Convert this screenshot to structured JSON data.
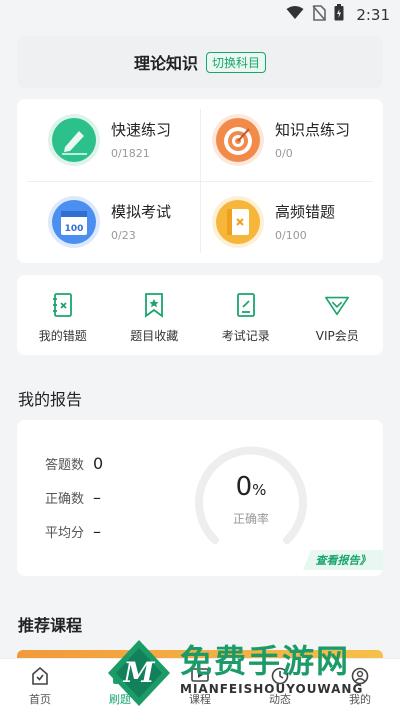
{
  "status": {
    "time": "2:31"
  },
  "subject": {
    "title": "理论知识",
    "switch_label": "切换科目"
  },
  "practice": [
    {
      "title": "快速练习",
      "count": "0/1821",
      "icon": "pen-icon"
    },
    {
      "title": "知识点练习",
      "count": "0/0",
      "icon": "target-icon"
    },
    {
      "title": "模拟考试",
      "count": "0/23",
      "icon": "exam-calendar-icon"
    },
    {
      "title": "高频错题",
      "count": "0/100",
      "icon": "wrong-book-icon"
    }
  ],
  "tools": [
    {
      "label": "我的错题",
      "icon": "wrong-notebook-icon"
    },
    {
      "label": "题目收藏",
      "icon": "bookmark-star-icon"
    },
    {
      "label": "考试记录",
      "icon": "exam-record-icon"
    },
    {
      "label": "VIP会员",
      "icon": "diamond-icon"
    }
  ],
  "report": {
    "title": "我的报告",
    "answered_label": "答题数",
    "answered_value": "0",
    "correct_label": "正确数",
    "correct_value": "–",
    "avg_label": "平均分",
    "avg_value": "–",
    "rate_value": "0",
    "rate_unit": "%",
    "rate_label": "正确率",
    "view_label": "查看报告》"
  },
  "courses": {
    "title": "推荐课程"
  },
  "tabs": [
    {
      "label": "首页",
      "icon": "home-icon",
      "active": false
    },
    {
      "label": "刷题",
      "icon": "practice-icon",
      "active": true
    },
    {
      "label": "课程",
      "icon": "course-icon",
      "active": false
    },
    {
      "label": "动态",
      "icon": "news-icon",
      "active": false
    },
    {
      "label": "我的",
      "icon": "profile-icon",
      "active": false
    }
  ],
  "watermark": {
    "title": "免费手游网",
    "subtitle": "MIANFEISHOUYOUWANG"
  },
  "colors": {
    "accent": "#1aa56d",
    "background": "#f3f4f6"
  }
}
